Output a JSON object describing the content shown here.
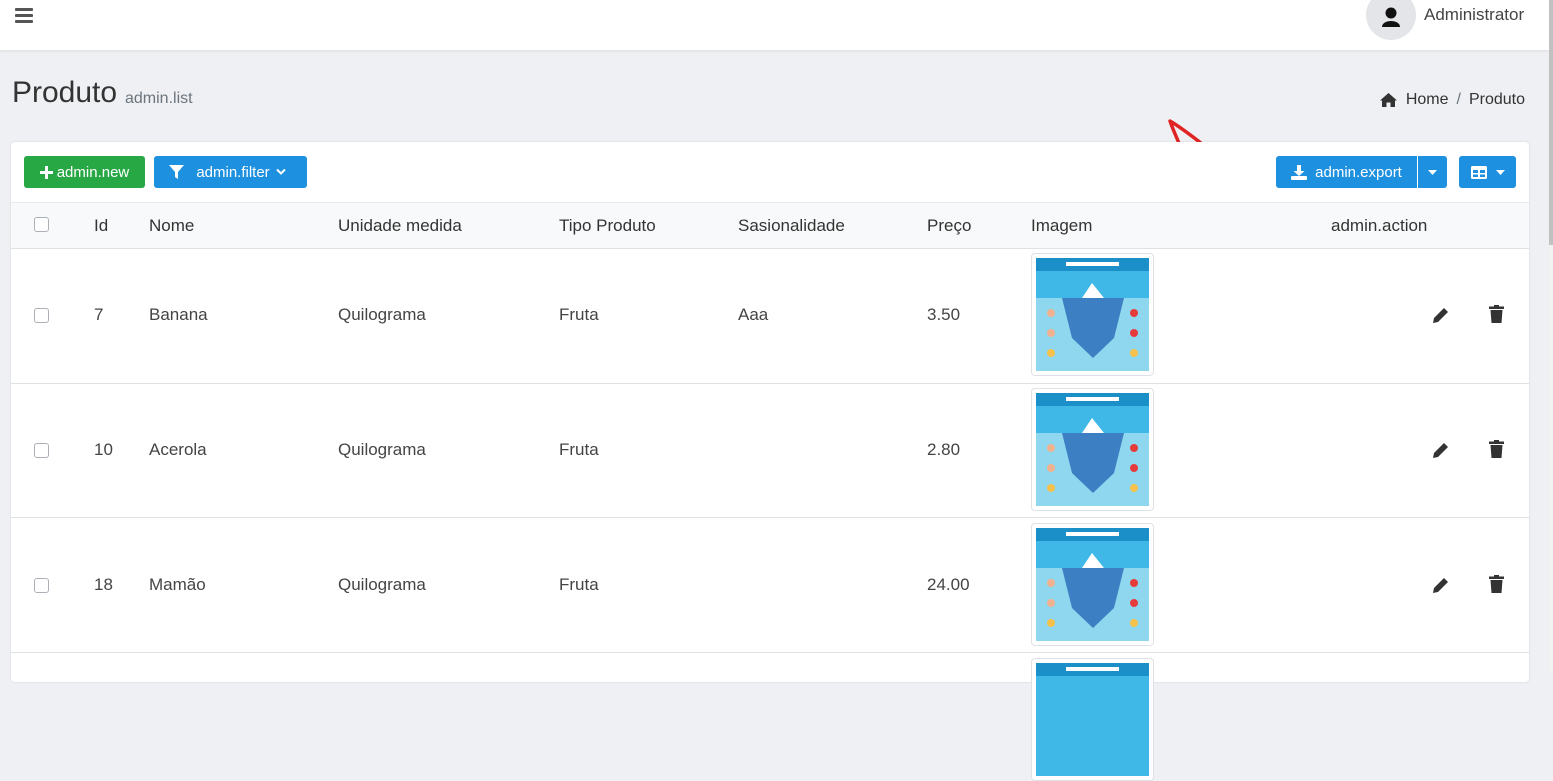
{
  "header": {
    "user_name": "Administrator"
  },
  "page": {
    "title": "Produto",
    "subtitle": "admin.list",
    "breadcrumb": {
      "home": "Home",
      "separator": "/",
      "current": "Produto"
    }
  },
  "toolbar": {
    "new_label": "admin.new",
    "filter_label": "admin.filter",
    "export_label": "admin.export"
  },
  "table": {
    "columns": {
      "id": "Id",
      "nome": "Nome",
      "unidade": "Unidade medida",
      "tipo": "Tipo Produto",
      "sasionalidade": "Sasionalidade",
      "preco": "Preço",
      "imagem": "Imagem",
      "action": "admin.action"
    },
    "rows": [
      {
        "id": "7",
        "nome": "Banana",
        "unidade": "Quilograma",
        "tipo": "Fruta",
        "sasionalidade": "Aaa",
        "preco": "3.50"
      },
      {
        "id": "10",
        "nome": "Acerola",
        "unidade": "Quilograma",
        "tipo": "Fruta",
        "sasionalidade": "",
        "preco": "2.80"
      },
      {
        "id": "18",
        "nome": "Mamão",
        "unidade": "Quilograma",
        "tipo": "Fruta",
        "sasionalidade": "",
        "preco": "24.00"
      }
    ]
  },
  "colors": {
    "primary": "#1e90e0",
    "success": "#28a745",
    "annotation_arrow": "#e02424"
  },
  "icons": [
    "hamburger-icon",
    "user-icon",
    "home-icon",
    "plus-icon",
    "filter-icon",
    "chevron-down-icon",
    "download-icon",
    "caret-down-icon",
    "table-columns-icon",
    "pencil-icon",
    "trash-icon"
  ]
}
